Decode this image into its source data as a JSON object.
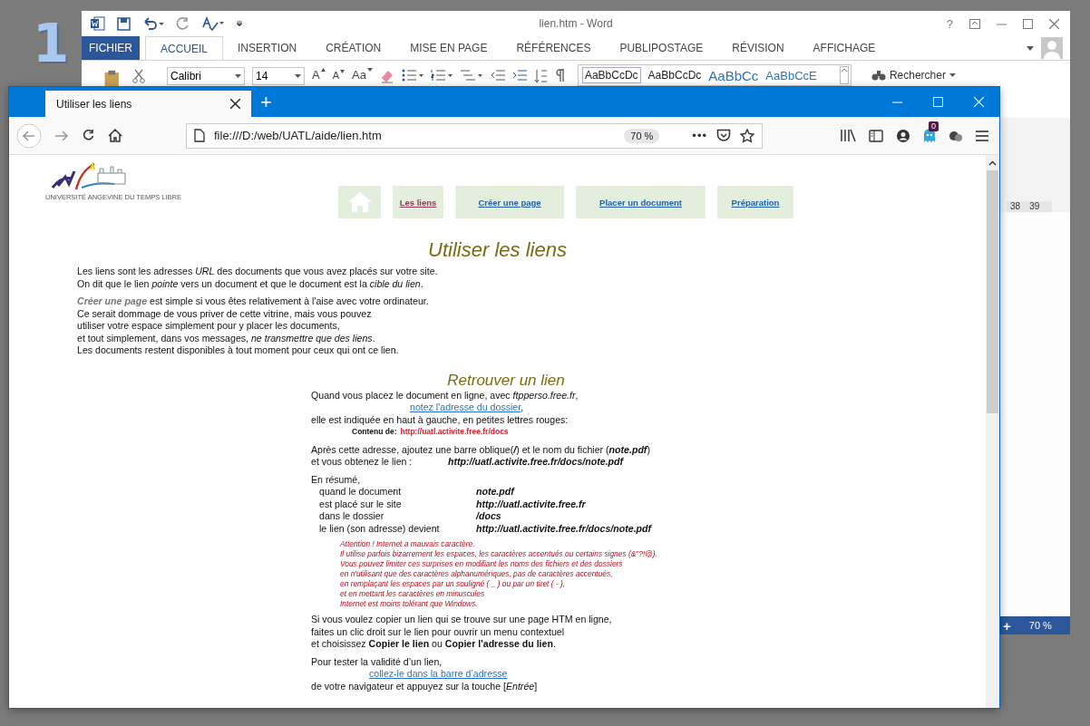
{
  "desktop": {
    "badge": "1"
  },
  "word": {
    "title": "lien.htm - Word",
    "tabs": [
      {
        "label": "FICHIER",
        "kind": "file",
        "selected": false
      },
      {
        "label": "ACCUEIL",
        "kind": "tab",
        "selected": true
      },
      {
        "label": "INSERTION",
        "kind": "tab",
        "selected": false
      },
      {
        "label": "CRÉATION",
        "kind": "tab",
        "selected": false
      },
      {
        "label": "MISE EN PAGE",
        "kind": "tab",
        "selected": false
      },
      {
        "label": "RÉFÉRENCES",
        "kind": "tab",
        "selected": false
      },
      {
        "label": "PUBLIPOSTAGE",
        "kind": "tab",
        "selected": false
      },
      {
        "label": "RÉVISION",
        "kind": "tab",
        "selected": false
      },
      {
        "label": "AFFICHAGE",
        "kind": "tab",
        "selected": false
      }
    ],
    "help": "?",
    "font_name": "Calibri",
    "font_size": "14",
    "grow_font": "A",
    "shrink_font": "A",
    "case_button": "Aa",
    "styles": [
      "AaBbCcDc",
      "AaBbCcDc",
      "AaBbCc",
      "AaBbCcE"
    ],
    "search": "Rechercher",
    "ruler": [
      "38",
      "39"
    ],
    "zoom_plus": "+",
    "zoom": "70 %"
  },
  "browser": {
    "tab_title": "Utiliser les liens",
    "new_tab": "+",
    "url": "file:///D:/web/UATL/aide/lien.htm",
    "zoom": "70 %",
    "more": "•••",
    "extension_badge": "0"
  },
  "page": {
    "logo_caption": "UNIVERSITÉ ANGEVINE DU TEMPS LIBRE",
    "nav": [
      {
        "kind": "home",
        "selected": false
      },
      {
        "kind": "link",
        "label": "Les liens",
        "selected": true
      },
      {
        "kind": "link",
        "label": "Créer une page",
        "selected": false
      },
      {
        "kind": "link",
        "label": "Placer un document",
        "selected": false
      },
      {
        "kind": "link",
        "label": "Préparation",
        "selected": false
      }
    ],
    "title": "Utiliser les liens",
    "intro": [
      {
        "lines": [
          "Les liens sont les adresses *URL* des documents que vous avez placés sur votre site.",
          "On dit que le lien *pointe* vers un document et que le document est la *cible du lien*."
        ]
      },
      {
        "lead": "Créer une page",
        "lines": [
          " est simple si vous êtes relativement à l'aise avec votre ordinateur.",
          "Ce serait dommage de vous priver de cette vitrine, mais vous pouvez",
          "utiliser votre espace simplement pour y placer les documents,",
          "et tout simplement, dans vos messages, *ne transmettre que des liens*.",
          "Les documents restent disponibles à tout moment pour ceux qui ont ce lien."
        ]
      }
    ],
    "section_title": "Retrouver un lien",
    "find_intro": "Quand vous placez le document en ligne, avec *ftpperso.free.fr*,",
    "find_link": "notez l'adresse du dossier",
    "find_link_after": ",",
    "find_where": "elle est indiquée en haut à gauche, en petites lettres rouges:",
    "contents_label": "Contenu de:",
    "contents_url": "http://uatl.activite.free.fr/docs",
    "append": "Après cette adresse, ajoutez une barre oblique(**/**) et le nom du fichier (**note.pdf**)",
    "result_label": "et vous obtenez le lien :",
    "result_value": "http://uatl.activite.free.fr/docs/note.pdf",
    "summary_title": "En résumé,",
    "summary": [
      {
        "label": "quand le document",
        "value": "note.pdf"
      },
      {
        "label": "est placé sur le site",
        "value": "http://uatl.activite.free.fr"
      },
      {
        "label": "dans le dossier",
        "value": "/docs"
      },
      {
        "label": "le lien (son adresse) devient",
        "value": "http://uatl.activite.free.fr/docs/note.pdf"
      }
    ],
    "warning": [
      "Attention !  Internet a mauvais caractère.",
      "Il utilise parfois bizarrement les espaces, les caractères accentués ou certains signes (&\"?!@).",
      "Vous pouvez limiter ces surprises en modifiant les noms des fichiers et des dossiers",
      "en n'utilisant que des caractères alphanumériques, pas de caractères accentués,",
      "en remplaçant les espaces par un souligné ( _ ) ou par un tiret ( - ),",
      "et en mettant les caractères en minuscules",
      "Internet est moins tolérant que Windows."
    ],
    "copy": [
      "Si vous voulez copier un lien qui se trouve sur une page HTM en ligne,",
      "faites un clic droit sur le lien pour ouvrir un menu contextuel",
      "et choisissez **Copier le lien** ou **Copier l'adresse du lien**."
    ],
    "test_intro": "Pour tester la validité d’un lien,",
    "test_link": "collez-le dans la barre d’adresse",
    "test_end": "de votre navigateur et appuyez sur la touche [*Entrée*]"
  }
}
